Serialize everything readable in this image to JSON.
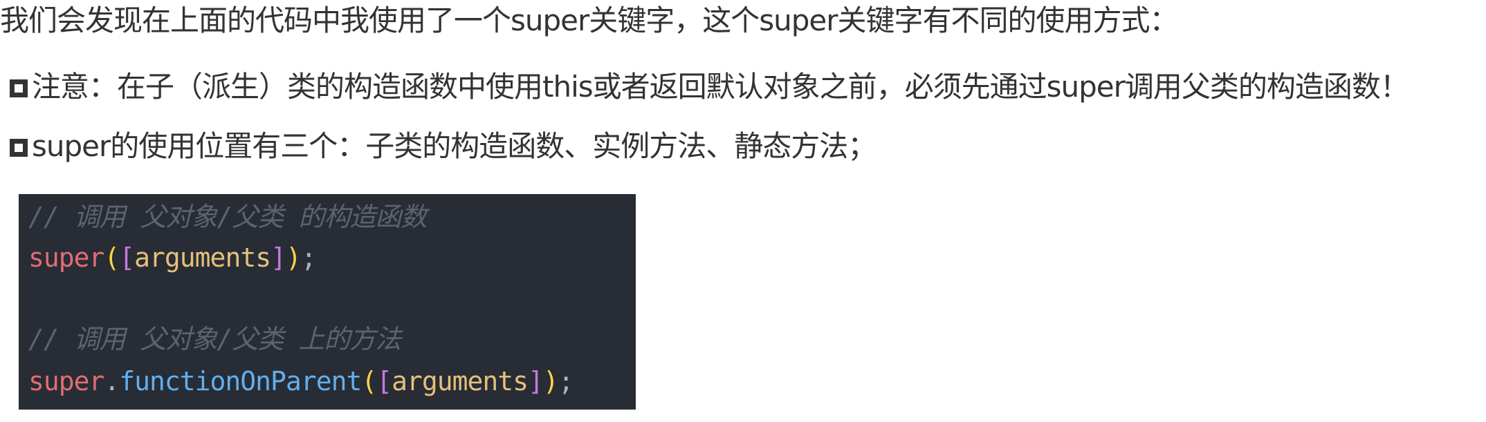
{
  "text": {
    "intro": "我们会发现在上面的代码中我使用了一个super关键字，这个super关键字有不同的使用方式：",
    "bullets": [
      "注意：在子（派生）类的构造函数中使用this或者返回默认对象之前，必须先通过super调用父类的构造函数！",
      "super的使用位置有三个：子类的构造函数、实例方法、静态方法；"
    ],
    "bullet_icon": "hollow-square"
  },
  "code": {
    "comment1": "// 调用 父对象/父类 的构造函数",
    "line2": {
      "kw": "super",
      "open_paren": "(",
      "open_bracket": "[",
      "arg": "arguments",
      "close_bracket": "]",
      "close_paren": ")",
      "semi": ";"
    },
    "comment2": "// 调用 父对象/父类 上的方法",
    "line4": {
      "kw": "super",
      "dot": ".",
      "fn": "functionOnParent",
      "open_paren": "(",
      "open_bracket": "[",
      "arg": "arguments",
      "close_bracket": "]",
      "close_paren": ")",
      "semi": ";"
    },
    "colors": {
      "background": "#282c34",
      "keyword": "#e06c75",
      "function": "#61afef",
      "argument": "#e5c07b",
      "comment": "#5c6370",
      "paren": "#f5d547",
      "bracket": "#c678dd"
    }
  }
}
